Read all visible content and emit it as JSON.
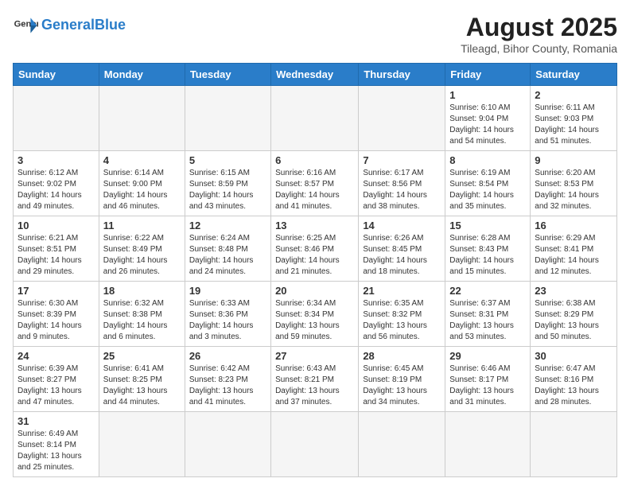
{
  "header": {
    "logo_general": "General",
    "logo_blue": "Blue",
    "month_year": "August 2025",
    "location": "Tileagd, Bihor County, Romania"
  },
  "weekdays": [
    "Sunday",
    "Monday",
    "Tuesday",
    "Wednesday",
    "Thursday",
    "Friday",
    "Saturday"
  ],
  "weeks": [
    [
      {
        "day": "",
        "info": ""
      },
      {
        "day": "",
        "info": ""
      },
      {
        "day": "",
        "info": ""
      },
      {
        "day": "",
        "info": ""
      },
      {
        "day": "",
        "info": ""
      },
      {
        "day": "1",
        "info": "Sunrise: 6:10 AM\nSunset: 9:04 PM\nDaylight: 14 hours and 54 minutes."
      },
      {
        "day": "2",
        "info": "Sunrise: 6:11 AM\nSunset: 9:03 PM\nDaylight: 14 hours and 51 minutes."
      }
    ],
    [
      {
        "day": "3",
        "info": "Sunrise: 6:12 AM\nSunset: 9:02 PM\nDaylight: 14 hours and 49 minutes."
      },
      {
        "day": "4",
        "info": "Sunrise: 6:14 AM\nSunset: 9:00 PM\nDaylight: 14 hours and 46 minutes."
      },
      {
        "day": "5",
        "info": "Sunrise: 6:15 AM\nSunset: 8:59 PM\nDaylight: 14 hours and 43 minutes."
      },
      {
        "day": "6",
        "info": "Sunrise: 6:16 AM\nSunset: 8:57 PM\nDaylight: 14 hours and 41 minutes."
      },
      {
        "day": "7",
        "info": "Sunrise: 6:17 AM\nSunset: 8:56 PM\nDaylight: 14 hours and 38 minutes."
      },
      {
        "day": "8",
        "info": "Sunrise: 6:19 AM\nSunset: 8:54 PM\nDaylight: 14 hours and 35 minutes."
      },
      {
        "day": "9",
        "info": "Sunrise: 6:20 AM\nSunset: 8:53 PM\nDaylight: 14 hours and 32 minutes."
      }
    ],
    [
      {
        "day": "10",
        "info": "Sunrise: 6:21 AM\nSunset: 8:51 PM\nDaylight: 14 hours and 29 minutes."
      },
      {
        "day": "11",
        "info": "Sunrise: 6:22 AM\nSunset: 8:49 PM\nDaylight: 14 hours and 26 minutes."
      },
      {
        "day": "12",
        "info": "Sunrise: 6:24 AM\nSunset: 8:48 PM\nDaylight: 14 hours and 24 minutes."
      },
      {
        "day": "13",
        "info": "Sunrise: 6:25 AM\nSunset: 8:46 PM\nDaylight: 14 hours and 21 minutes."
      },
      {
        "day": "14",
        "info": "Sunrise: 6:26 AM\nSunset: 8:45 PM\nDaylight: 14 hours and 18 minutes."
      },
      {
        "day": "15",
        "info": "Sunrise: 6:28 AM\nSunset: 8:43 PM\nDaylight: 14 hours and 15 minutes."
      },
      {
        "day": "16",
        "info": "Sunrise: 6:29 AM\nSunset: 8:41 PM\nDaylight: 14 hours and 12 minutes."
      }
    ],
    [
      {
        "day": "17",
        "info": "Sunrise: 6:30 AM\nSunset: 8:39 PM\nDaylight: 14 hours and 9 minutes."
      },
      {
        "day": "18",
        "info": "Sunrise: 6:32 AM\nSunset: 8:38 PM\nDaylight: 14 hours and 6 minutes."
      },
      {
        "day": "19",
        "info": "Sunrise: 6:33 AM\nSunset: 8:36 PM\nDaylight: 14 hours and 3 minutes."
      },
      {
        "day": "20",
        "info": "Sunrise: 6:34 AM\nSunset: 8:34 PM\nDaylight: 13 hours and 59 minutes."
      },
      {
        "day": "21",
        "info": "Sunrise: 6:35 AM\nSunset: 8:32 PM\nDaylight: 13 hours and 56 minutes."
      },
      {
        "day": "22",
        "info": "Sunrise: 6:37 AM\nSunset: 8:31 PM\nDaylight: 13 hours and 53 minutes."
      },
      {
        "day": "23",
        "info": "Sunrise: 6:38 AM\nSunset: 8:29 PM\nDaylight: 13 hours and 50 minutes."
      }
    ],
    [
      {
        "day": "24",
        "info": "Sunrise: 6:39 AM\nSunset: 8:27 PM\nDaylight: 13 hours and 47 minutes."
      },
      {
        "day": "25",
        "info": "Sunrise: 6:41 AM\nSunset: 8:25 PM\nDaylight: 13 hours and 44 minutes."
      },
      {
        "day": "26",
        "info": "Sunrise: 6:42 AM\nSunset: 8:23 PM\nDaylight: 13 hours and 41 minutes."
      },
      {
        "day": "27",
        "info": "Sunrise: 6:43 AM\nSunset: 8:21 PM\nDaylight: 13 hours and 37 minutes."
      },
      {
        "day": "28",
        "info": "Sunrise: 6:45 AM\nSunset: 8:19 PM\nDaylight: 13 hours and 34 minutes."
      },
      {
        "day": "29",
        "info": "Sunrise: 6:46 AM\nSunset: 8:17 PM\nDaylight: 13 hours and 31 minutes."
      },
      {
        "day": "30",
        "info": "Sunrise: 6:47 AM\nSunset: 8:16 PM\nDaylight: 13 hours and 28 minutes."
      }
    ],
    [
      {
        "day": "31",
        "info": "Sunrise: 6:49 AM\nSunset: 8:14 PM\nDaylight: 13 hours and 25 minutes."
      },
      {
        "day": "",
        "info": ""
      },
      {
        "day": "",
        "info": ""
      },
      {
        "day": "",
        "info": ""
      },
      {
        "day": "",
        "info": ""
      },
      {
        "day": "",
        "info": ""
      },
      {
        "day": "",
        "info": ""
      }
    ]
  ]
}
